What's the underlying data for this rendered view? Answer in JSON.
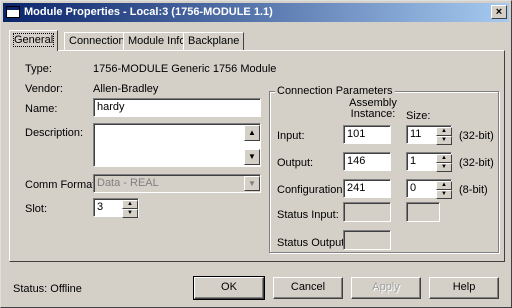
{
  "window": {
    "title": "Module Properties - Local:3 (1756-MODULE 1.1)",
    "close_label": "×"
  },
  "tabs": [
    {
      "label": "General"
    },
    {
      "label": "Connection"
    },
    {
      "label": "Module Info"
    },
    {
      "label": "Backplane"
    }
  ],
  "general": {
    "type_label": "Type:",
    "type_value": "1756-MODULE Generic 1756 Module",
    "vendor_label": "Vendor:",
    "vendor_value": "Allen-Bradley",
    "name_label": "Name:",
    "name_value": "hardy",
    "description_label": "Description:",
    "description_value": "",
    "comm_format_label": "Comm Format:",
    "comm_format_value": "Data - REAL",
    "slot_label": "Slot:",
    "slot_value": "3"
  },
  "connection_params": {
    "title": "Connection Parameters",
    "assembly_instance_header": "Assembly Instance:",
    "size_header": "Size:",
    "rows": [
      {
        "label": "Input:",
        "instance": "101",
        "size": "11",
        "unit": "(32-bit)"
      },
      {
        "label": "Output:",
        "instance": "146",
        "size": "1",
        "unit": "(32-bit)"
      },
      {
        "label": "Configuration:",
        "instance": "241",
        "size": "0",
        "unit": "(8-bit)"
      }
    ],
    "status_input_label": "Status Input:",
    "status_output_label": "Status Output:"
  },
  "footer": {
    "status_text": "Status:  Offline",
    "ok_label": "OK",
    "cancel_label": "Cancel",
    "apply_label": "Apply",
    "help_label": "Help"
  }
}
